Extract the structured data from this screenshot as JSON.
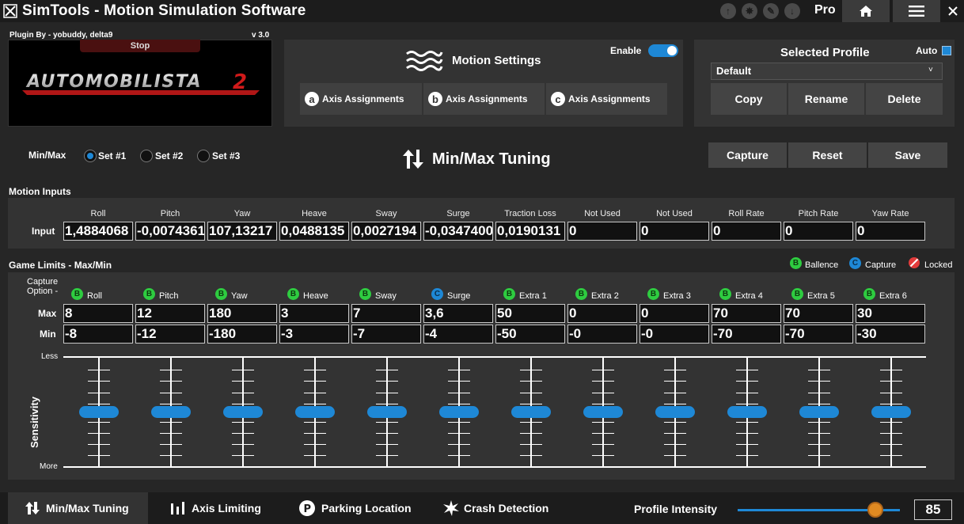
{
  "titlebar": {
    "title": "SimTools - Motion Simulation Software",
    "edition": "Pro"
  },
  "plugin": {
    "by": "Plugin By - yobuddy, delta9",
    "version": "v 3.0",
    "stop_label": "Stop",
    "game_logo": "AUTOMOBILISTA 2"
  },
  "motion_settings": {
    "title": "Motion Settings",
    "enable_label": "Enable",
    "enabled": true,
    "axis_buttons": [
      {
        "letter": "a",
        "label": "Axis Assignments"
      },
      {
        "letter": "b",
        "label": "Axis Assignments"
      },
      {
        "letter": "c",
        "label": "Axis Assignments"
      }
    ]
  },
  "profile": {
    "title": "Selected Profile",
    "auto_label": "Auto",
    "auto_checked": true,
    "selected": "Default",
    "caret": "˅",
    "buttons": [
      "Copy",
      "Rename",
      "Delete"
    ]
  },
  "minmax": {
    "label": "Min/Max",
    "sets": [
      "Set #1",
      "Set #2",
      "Set #3"
    ],
    "selected_set": 0,
    "title": "Min/Max Tuning",
    "buttons": [
      "Capture",
      "Reset",
      "Save"
    ]
  },
  "motion_inputs": {
    "title": "Motion Inputs",
    "row_label": "Input",
    "columns": [
      "Roll",
      "Pitch",
      "Yaw",
      "Heave",
      "Sway",
      "Surge",
      "Traction Loss",
      "Not Used",
      "Not Used",
      "Roll Rate",
      "Pitch Rate",
      "Yaw Rate"
    ],
    "values": [
      "1,4884068",
      "-0,0074361",
      "107,13217",
      "0,0488135",
      "0,0027194",
      "-0,0347400",
      "0,0190131",
      "0",
      "0",
      "0",
      "0",
      "0"
    ]
  },
  "game_limits": {
    "title": "Game Limits - Max/Min",
    "legend": [
      {
        "letter": "B",
        "label": "Ballence",
        "color": "#2ecc40"
      },
      {
        "letter": "C",
        "label": "Capture",
        "color": "#1e88d6"
      },
      {
        "letter": "",
        "label": "Locked",
        "color": "#e23b3b"
      }
    ],
    "capture_option_label": "Capture Option -",
    "max_label": "Max",
    "min_label": "Min",
    "columns": [
      {
        "option": "B",
        "name": "Roll",
        "max": "8",
        "min": "-8"
      },
      {
        "option": "B",
        "name": "Pitch",
        "max": "12",
        "min": "-12"
      },
      {
        "option": "B",
        "name": "Yaw",
        "max": "180",
        "min": "-180"
      },
      {
        "option": "B",
        "name": "Heave",
        "max": "3",
        "min": "-3"
      },
      {
        "option": "B",
        "name": "Sway",
        "max": "7",
        "min": "-7"
      },
      {
        "option": "C",
        "name": "Surge",
        "max": "3,6",
        "min": "-4"
      },
      {
        "option": "B",
        "name": "Extra 1",
        "max": "50",
        "min": "-50"
      },
      {
        "option": "B",
        "name": "Extra 2",
        "max": "0",
        "min": "-0"
      },
      {
        "option": "B",
        "name": "Extra 3",
        "max": "0",
        "min": "-0"
      },
      {
        "option": "B",
        "name": "Extra 4",
        "max": "70",
        "min": "-70"
      },
      {
        "option": "B",
        "name": "Extra 5",
        "max": "70",
        "min": "-70"
      },
      {
        "option": "B",
        "name": "Extra 6",
        "max": "30",
        "min": "-30"
      }
    ],
    "sensitivity_label": "Sensitivity",
    "less_label": "Less",
    "more_label": "More",
    "slider_level": 0.5
  },
  "bottom_nav": {
    "items": [
      "Min/Max Tuning",
      "Axis Limiting",
      "Parking Location",
      "Crash Detection"
    ],
    "active": 0,
    "intensity_label": "Profile Intensity",
    "intensity_value": "85",
    "intensity_fraction": 0.85
  },
  "colors": {
    "accent": "#1e88d6",
    "balance": "#2ecc40",
    "locked": "#e23b3b",
    "intensity_knob": "#e08a22"
  }
}
